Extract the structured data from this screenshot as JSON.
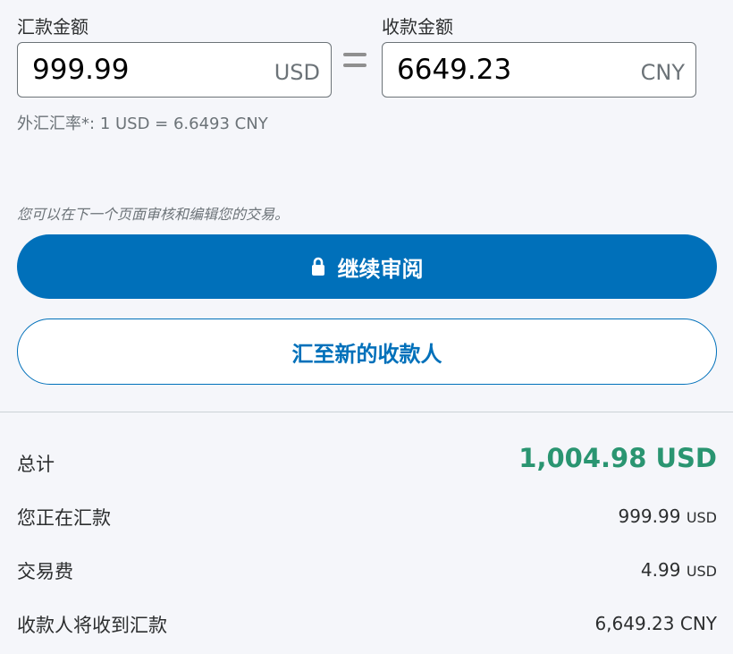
{
  "send": {
    "label": "汇款金额",
    "amount": "999.99",
    "currency": "USD"
  },
  "receive": {
    "label": "收款金额",
    "amount": "6649.23",
    "currency": "CNY"
  },
  "exchange_rate": {
    "label": "外汇汇率*:",
    "value": "1 USD = 6.6493 CNY"
  },
  "review_note": "您可以在下一个页面审核和编辑您的交易。",
  "buttons": {
    "continue_label": "继续审阅",
    "new_recipient_label": "汇至新的收款人"
  },
  "summary": {
    "total_label": "总计",
    "total_value": "1,004.98 USD",
    "sending_label": "您正在汇款",
    "sending_amount": "999.99",
    "sending_currency": "USD",
    "fee_label": "交易费",
    "fee_amount": "4.99",
    "fee_currency": "USD",
    "recipient_label": "收款人将收到汇款",
    "recipient_value": "6,649.23 CNY"
  },
  "colors": {
    "primary_blue": "#0070ba",
    "total_green": "#2a9571",
    "background": "#f5f6fa"
  }
}
